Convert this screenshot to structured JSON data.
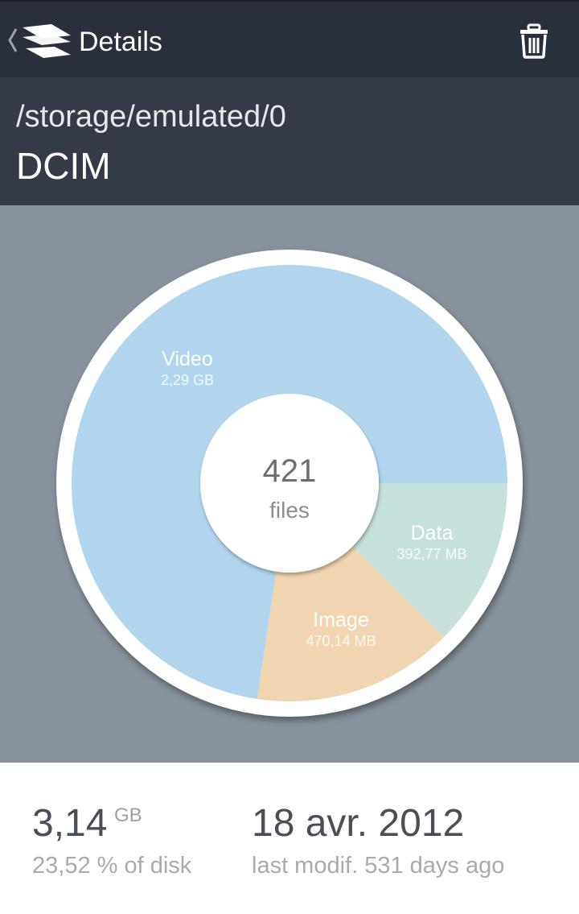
{
  "appbar": {
    "title": "Details",
    "back_icon": "chevron-left-icon",
    "logo_icon": "app-logo-icon",
    "delete_icon": "trash-icon"
  },
  "path": {
    "directory": "/storage/emulated/0",
    "folder": "DCIM"
  },
  "summary": {
    "file_count": "421",
    "file_unit": "files"
  },
  "chart_data": {
    "type": "pie",
    "title": "",
    "unit": "GB",
    "categories": [
      "Video",
      "Image",
      "Data"
    ],
    "display_values": [
      "2,29 GB",
      "470,14 MB",
      "392,77 MB"
    ],
    "values": [
      2.29,
      0.47014,
      0.39277
    ],
    "colors": [
      "#b1d5ed",
      "#efd5b0",
      "#c6e0dc"
    ],
    "center_label": "421 files"
  },
  "stats": {
    "size_value": "3,14",
    "size_unit": "GB",
    "disk_share": "23,52 % of disk",
    "modified_date": "18 avr. 2012",
    "modified_ago": "last modif. 531 days ago"
  },
  "colors": {
    "appbar": "#2a303b",
    "pathbar": "#343b47",
    "chart_background": "#87919c"
  }
}
